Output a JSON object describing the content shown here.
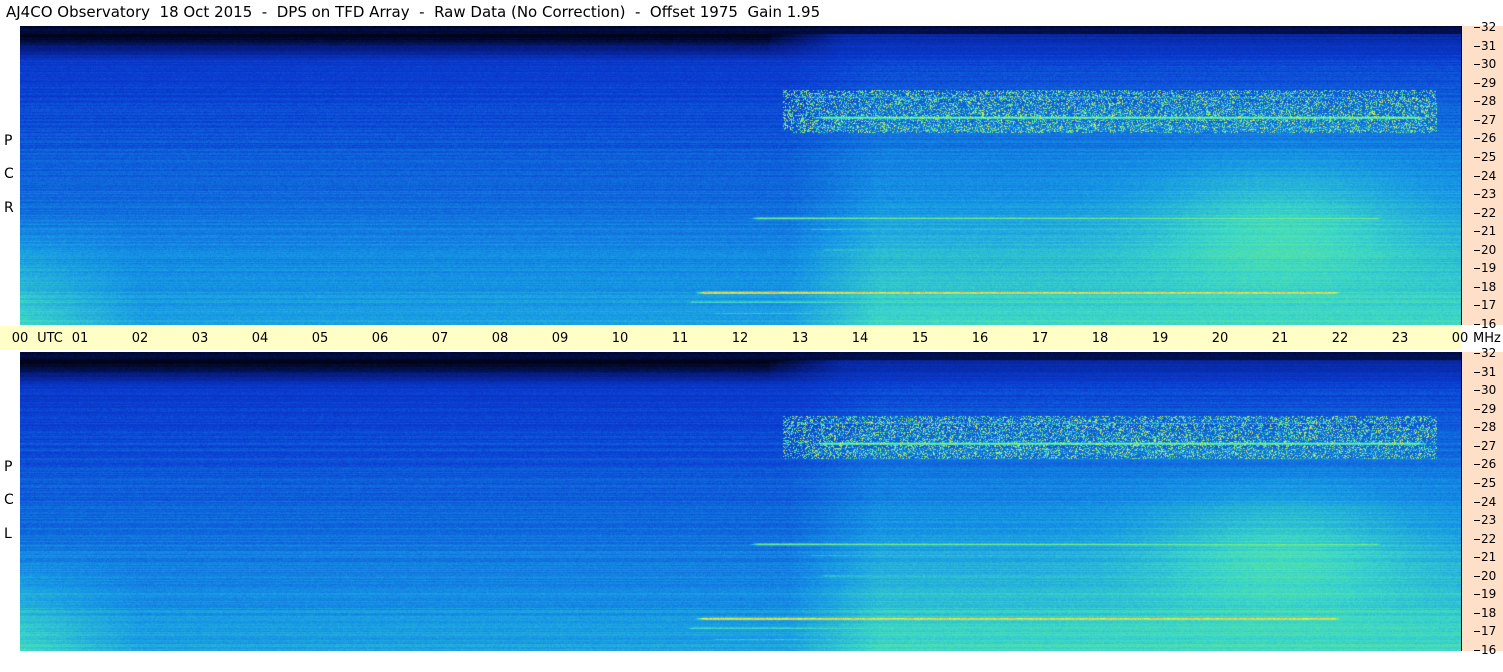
{
  "title": "AJ4CO Observatory  18 Oct 2015  -  DPS on TFD Array  -  Raw Data (No Correction)  -  Offset 1975  Gain 1.95",
  "panels": {
    "top": {
      "polarization": [
        "P",
        "C",
        "R"
      ]
    },
    "bottom": {
      "polarization": [
        "P",
        "C",
        "L"
      ]
    }
  },
  "time_axis": {
    "labels": [
      "00",
      "UTC",
      "01",
      "02",
      "03",
      "04",
      "05",
      "06",
      "07",
      "08",
      "09",
      "10",
      "11",
      "12",
      "13",
      "14",
      "15",
      "16",
      "17",
      "18",
      "19",
      "20",
      "21",
      "22",
      "23",
      "00"
    ],
    "unit": "MHz"
  },
  "colors": {
    "background_dark": "#000820",
    "base_blue": "#0a3cc8",
    "mid_cyan": "#1aa8e8",
    "green": "#4ee89a",
    "yellow": "#f0f050",
    "hot": "#e83070",
    "time_bar": "#fffec6",
    "freq_bar": "#fde0c7"
  },
  "chart_data": {
    "type": "heatmap",
    "title": "AJ4CO Observatory  18 Oct 2015  -  DPS on TFD Array  -  Raw Data (No Correction)  -  Offset 1975  Gain 1.95",
    "x": {
      "label": "UTC",
      "range": [
        0,
        24
      ],
      "ticks": [
        0,
        1,
        2,
        3,
        4,
        5,
        6,
        7,
        8,
        9,
        10,
        11,
        12,
        13,
        14,
        15,
        16,
        17,
        18,
        19,
        20,
        21,
        22,
        23,
        24
      ]
    },
    "y": {
      "label": "MHz",
      "range": [
        16,
        32
      ],
      "ticks": [
        16,
        17,
        18,
        19,
        20,
        21,
        22,
        23,
        24,
        25,
        26,
        27,
        28,
        29,
        30,
        31,
        32
      ]
    },
    "panels": [
      "RCP",
      "LCP"
    ],
    "features": [
      {
        "name": "band_27",
        "freq": 27.1,
        "from": 13.0,
        "to": 23.7,
        "level": 0.85
      },
      {
        "name": "band_28",
        "freq": 28.2,
        "from": 12.6,
        "to": 22.5,
        "level": 0.55
      },
      {
        "name": "band_26_7",
        "freq": 26.6,
        "from": 12.8,
        "to": 23.3,
        "level": 0.55
      },
      {
        "name": "band_25",
        "freq": 25.0,
        "from": 12.5,
        "to": 22.4,
        "level": 0.5
      },
      {
        "name": "band_21_7",
        "freq": 21.7,
        "from": 11.9,
        "to": 23.0,
        "level": 0.8
      },
      {
        "name": "band_21_1",
        "freq": 21.1,
        "from": 12.8,
        "to": 23.9,
        "level": 0.6
      },
      {
        "name": "band_20",
        "freq": 20.0,
        "from": 13.0,
        "to": 24.0,
        "level": 0.7
      },
      {
        "name": "band_17_7",
        "freq": 17.7,
        "from": 11.0,
        "to": 22.3,
        "level": 1.0
      },
      {
        "name": "band_17_2",
        "freq": 17.2,
        "from": 10.8,
        "to": 24.0,
        "level": 0.75
      },
      {
        "name": "band_16_6",
        "freq": 16.6,
        "from": 11.2,
        "to": 24.0,
        "level": 0.65
      }
    ]
  }
}
